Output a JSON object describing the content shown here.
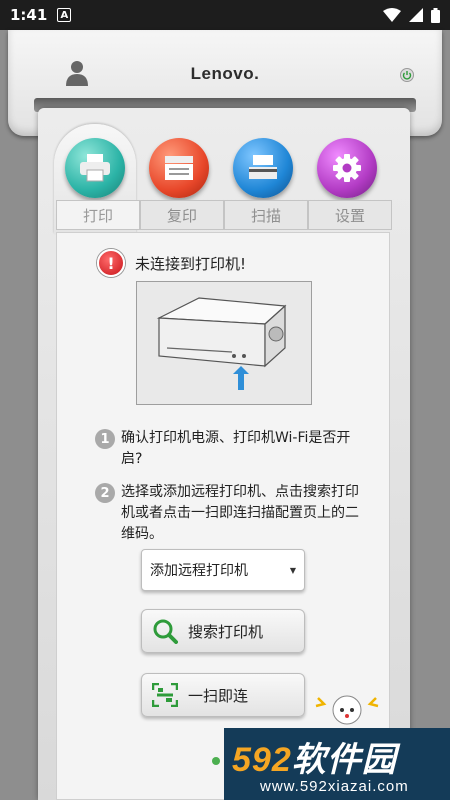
{
  "status_bar": {
    "time": "1:41",
    "notification_icon": "A"
  },
  "header": {
    "brand": "Lenovo.",
    "user_icon": "user-icon",
    "power_icon": "power-icon"
  },
  "tabs": [
    {
      "label": "打印",
      "icon": "printer-icon",
      "color": "#2bb3a6",
      "active": true
    },
    {
      "label": "复印",
      "icon": "copier-icon",
      "color": "#e8472a",
      "active": false
    },
    {
      "label": "扫描",
      "icon": "scanner-icon",
      "color": "#1f86d6",
      "active": false
    },
    {
      "label": "设置",
      "icon": "gear-icon",
      "color": "#b23bc4",
      "active": false
    }
  ],
  "content": {
    "alert_icon_text": "!",
    "alert_text": "未连接到打印机!",
    "steps": [
      {
        "num": "1",
        "text": "确认打印机电源、打印机Wi-Fi是否开启?"
      },
      {
        "num": "2",
        "text": "选择或添加远程打印机、点击搜索打印机或者点击一扫即连扫描配置页上的二维码。"
      }
    ],
    "select_value": "添加远程打印机",
    "search_button": "搜索打印机",
    "scan_button": "一扫即连"
  },
  "watermark": {
    "num": "592",
    "brand": "软件园",
    "url": "www.592xiazai.com"
  }
}
